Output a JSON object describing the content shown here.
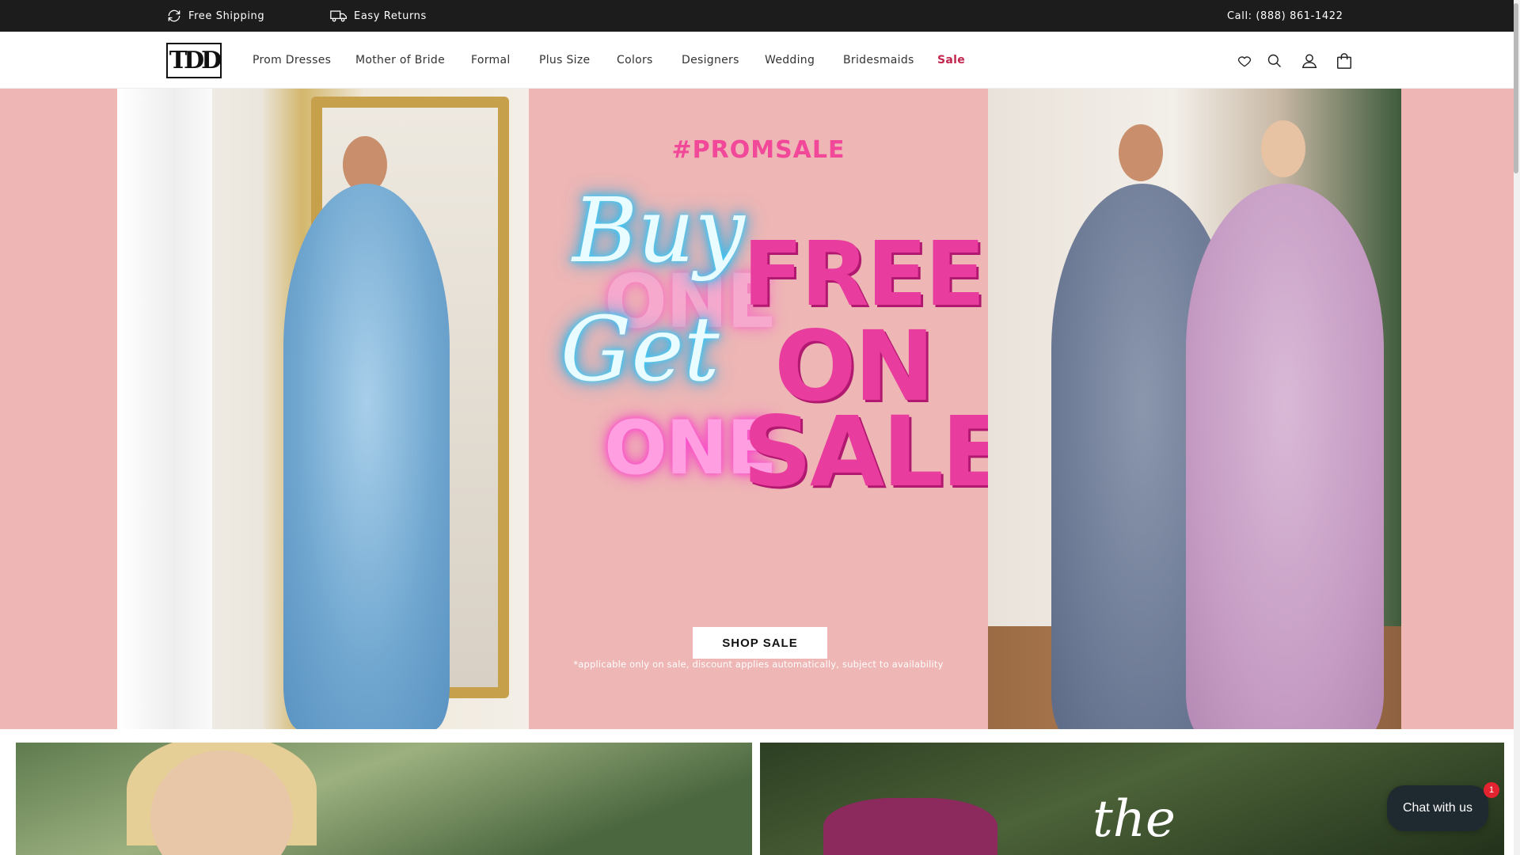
{
  "announcement": {
    "free_shipping": "Free Shipping",
    "free_shipping_icon": "refresh-icon",
    "easy_returns": "Easy Returns",
    "easy_returns_icon": "truck-icon",
    "phone": "Call: (888) 861-1422"
  },
  "header": {
    "logo_text": "TDD",
    "nav": [
      {
        "label": "Prom Dresses"
      },
      {
        "label": "Mother of Bride"
      },
      {
        "label": "Formal"
      },
      {
        "label": "Plus Size"
      },
      {
        "label": "Colors"
      },
      {
        "label": "Designers"
      },
      {
        "label": "Wedding"
      },
      {
        "label": "Bridesmaids"
      },
      {
        "label": "Sale"
      }
    ],
    "icons": [
      "heart-icon",
      "search-icon",
      "account-icon",
      "cart-icon"
    ]
  },
  "hero": {
    "hashtag": "#PROMSALE",
    "script_buy": "Buy",
    "script_get": "Get",
    "one_1": "ONE",
    "one_2": "ONE",
    "big_free": "FREE",
    "big_on": "ON",
    "big_sale": "SALE",
    "cta": "SHOP SALE",
    "disclaimer": "*applicable only on sale, discount applies automatically, subject to availability",
    "background_color": "#eeb6b5",
    "accent_color": "#e93c9f"
  },
  "tiles": {
    "right_script": "the"
  },
  "chat": {
    "label": "Chat with us",
    "badge": "1"
  }
}
